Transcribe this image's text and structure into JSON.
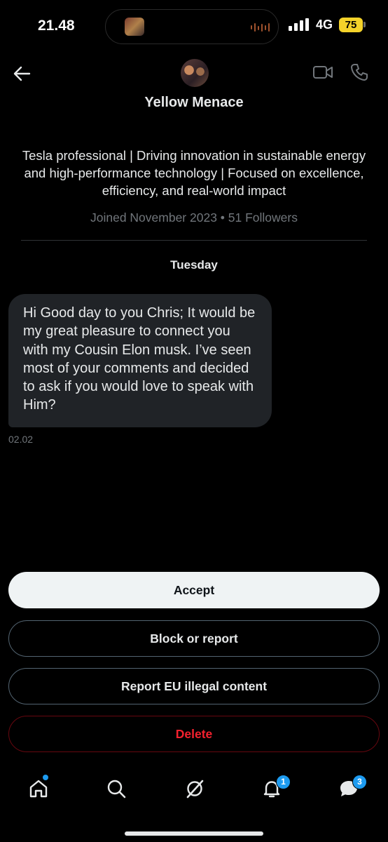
{
  "status_bar": {
    "time": "21.48",
    "network": "4G",
    "battery": "75",
    "battery_color": "#f5d32a"
  },
  "header": {
    "name": "Yellow Menace",
    "back_icon": "arrow-left-icon",
    "video_icon": "video-call-icon",
    "phone_icon": "phone-icon"
  },
  "profile": {
    "bio": "Tesla professional | Driving innovation in sustainable energy and high-performance technology | Focused on excellence, efficiency, and real-world impact",
    "meta": "Joined November 2023 • 51 Followers"
  },
  "conversation": {
    "day_label": "Tuesday",
    "messages": [
      {
        "text": "Hi Good day to you Chris; It would be my great pleasure to connect you with my Cousin Elon musk. I’ve seen most of your comments and decided to ask if you would love to speak with Him?",
        "time": "02.02"
      }
    ]
  },
  "actions": {
    "accept": "Accept",
    "block": "Block or report",
    "report_eu": "Report EU illegal content",
    "delete": "Delete",
    "delete_color": "#f4212e"
  },
  "tab_bar": {
    "notifications_badge": "1",
    "messages_badge": "3",
    "accent_color": "#1d9bf0"
  }
}
